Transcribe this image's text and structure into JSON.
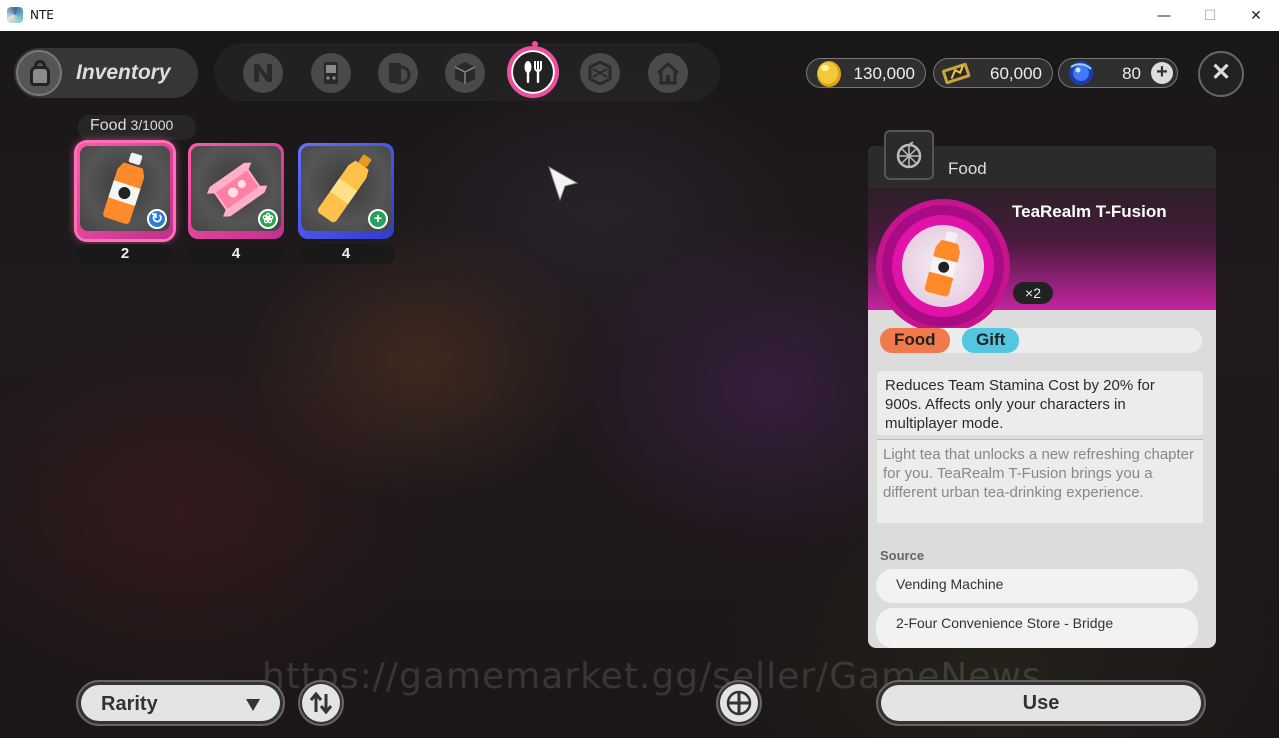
{
  "window": {
    "title": "NTE",
    "minimize": "—",
    "maximize": "☐",
    "close": "✕"
  },
  "header": {
    "title": "Inventory"
  },
  "tabs": [
    {
      "name": "tab-n-items",
      "icon": "n-logo-icon"
    },
    {
      "name": "tab-devices",
      "icon": "handheld-device-icon"
    },
    {
      "name": "tab-records",
      "icon": "record-card-icon"
    },
    {
      "name": "tab-materials",
      "icon": "cube-icon"
    },
    {
      "name": "tab-food",
      "icon": "fork-spoon-icon",
      "active": true
    },
    {
      "name": "tab-blueprints",
      "icon": "cube-wireframe-icon"
    },
    {
      "name": "tab-home",
      "icon": "home-icon"
    }
  ],
  "currencies": [
    {
      "icon": "gold-coin-icon",
      "value": "130,000"
    },
    {
      "icon": "ticket-icon",
      "value": "60,000"
    },
    {
      "icon": "blue-orb-icon",
      "value": "80"
    }
  ],
  "category": {
    "label": "Food",
    "count": "3/1000"
  },
  "items": [
    {
      "icon": "orange-bottle-icon",
      "count": "2",
      "rarity": "pink",
      "badge": "blue-swirl-icon",
      "badge_color": "#2f7bd9"
    },
    {
      "icon": "pink-wrapper-icon",
      "count": "4",
      "rarity": "pink",
      "badge": "green-leaf-icon",
      "badge_color": "#2aa34a"
    },
    {
      "icon": "yellow-bottle-icon",
      "count": "4",
      "rarity": "blue",
      "badge": "green-plus-icon",
      "badge_color": "#23a35a"
    }
  ],
  "detail": {
    "category": "Food",
    "name": "TeaRealm T-Fusion",
    "quantity": "×2",
    "tags": [
      "Food",
      "Gift"
    ],
    "effect": "Reduces Team Stamina Cost by 20% for 900s. Affects only your characters in multiplayer mode.",
    "description": "Light tea that unlocks a new refreshing chapter for you. TeaRealm T-Fusion brings you a different urban tea-drinking experience.",
    "source_label": "Source",
    "sources": [
      "Vending Machine",
      "2-Four Convenience Store - Bridge"
    ]
  },
  "footer": {
    "sort_label": "Rarity",
    "use_label": "Use"
  },
  "watermark": "https://gamemarket.gg/seller/GameNews",
  "colors": {
    "accent": "#f04d9c",
    "rarity_pink": "#e43a9a",
    "rarity_blue": "#4a55e8",
    "tag_food": "#f07a4c",
    "tag_gift": "#53c7e0"
  }
}
